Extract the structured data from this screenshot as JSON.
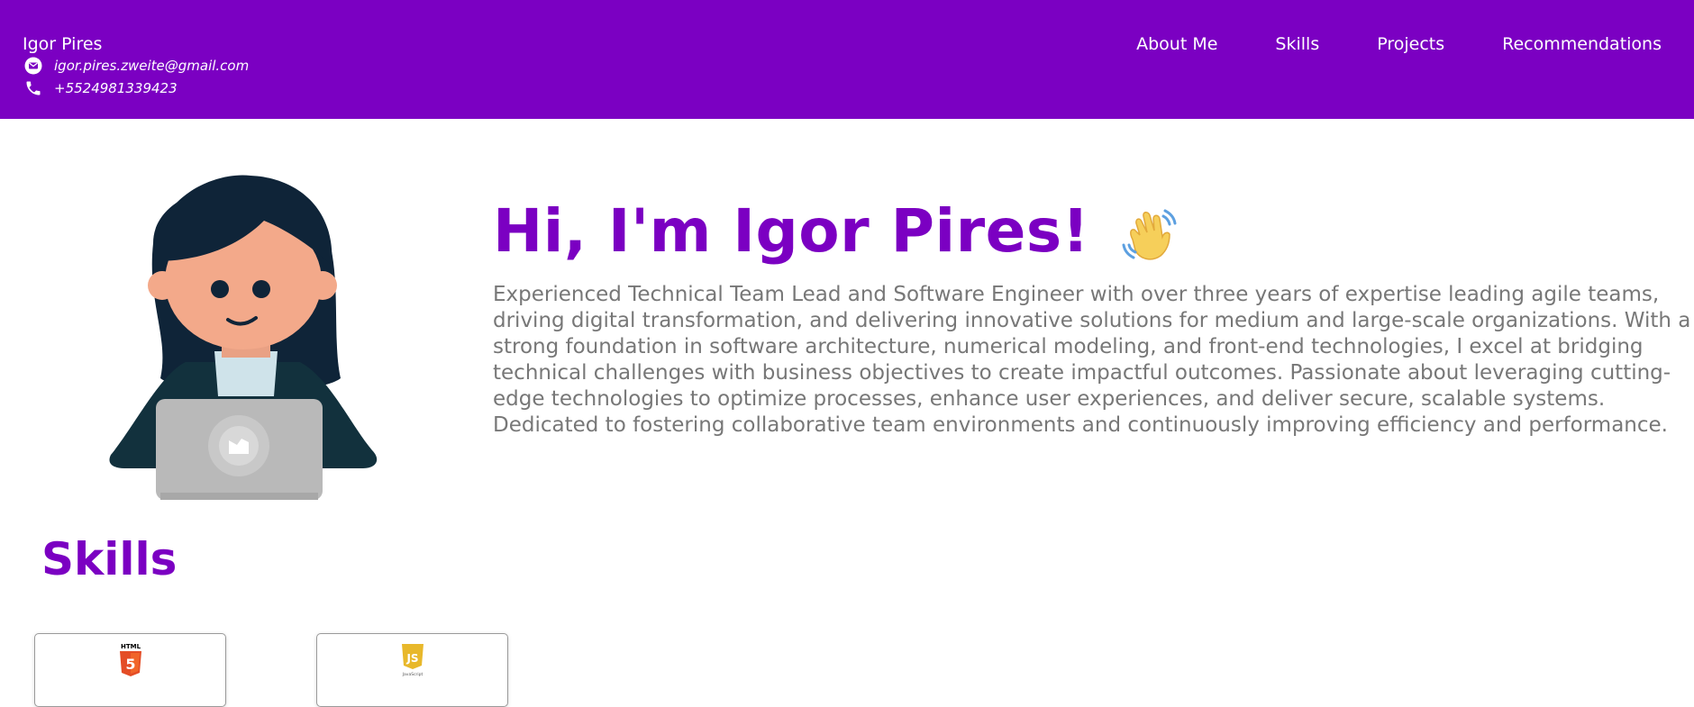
{
  "header": {
    "name": "Igor Pires",
    "email": "igor.pires.zweite@gmail.com",
    "phone": "+5524981339423",
    "email_icon": "envelope-icon",
    "phone_icon": "phone-icon",
    "background": "#7b00c2"
  },
  "nav": {
    "items": [
      {
        "label": "About Me"
      },
      {
        "label": "Skills"
      },
      {
        "label": "Projects"
      },
      {
        "label": "Recommendations"
      }
    ]
  },
  "hero": {
    "title": "Hi, I'm Igor Pires!",
    "title_icon": "waving-hand-icon",
    "avatar_icon": "developer-avatar-illustration",
    "description": "Experienced Technical Team Lead and Software Engineer with over three years of expertise leading agile teams, driving digital transformation, and delivering innovative solutions for medium and large-scale organizations. With a strong foundation in software architecture, numerical modeling, and front-end technologies, I excel at bridging technical challenges with business objectives to create impactful outcomes. Passionate about leveraging cutting-edge technologies to optimize processes, enhance user experiences, and deliver secure, scalable systems. Dedicated to fostering collaborative team environments and continuously improving efficiency and performance.",
    "accent": "#7b00c2",
    "text_color": "#777777"
  },
  "skills": {
    "title": "Skills",
    "cards": [
      {
        "icon": "html5-logo-icon",
        "logo_text": "HTML"
      },
      {
        "icon": "javascript-logo-icon",
        "logo_text": "JavaScript"
      }
    ]
  }
}
